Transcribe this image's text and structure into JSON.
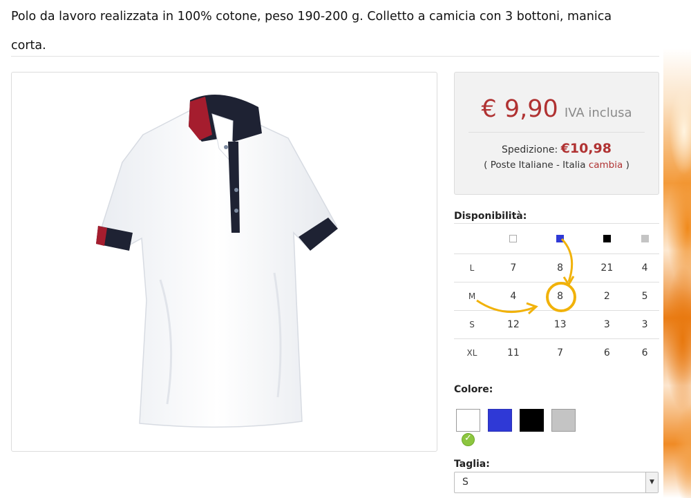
{
  "product": {
    "description": "Polo da lavoro realizzata in 100% cotone, peso 190-200 g. Colletto a camicia con 3 bottoni, manica corta."
  },
  "price": {
    "amount": "€ 9,90",
    "vat_note": "IVA inclusa"
  },
  "shipping": {
    "label": "Spedizione:",
    "price": "€10,98",
    "detail_open": "( Poste Italiane - Italia",
    "change_link": "cambia",
    "detail_close": ")"
  },
  "availability": {
    "label": "Disponibilità:",
    "colors": [
      {
        "name": "white",
        "hex": "#ffffff"
      },
      {
        "name": "blue",
        "hex": "#2f39d6"
      },
      {
        "name": "black",
        "hex": "#000000"
      },
      {
        "name": "grey",
        "hex": "#c4c4c4"
      }
    ],
    "rows": [
      {
        "size": "L",
        "values": [
          "7",
          "8",
          "21",
          "4"
        ]
      },
      {
        "size": "M",
        "values": [
          "4",
          "8",
          "2",
          "5"
        ]
      },
      {
        "size": "S",
        "values": [
          "12",
          "13",
          "3",
          "3"
        ]
      },
      {
        "size": "XL",
        "values": [
          "11",
          "7",
          "6",
          "6"
        ]
      }
    ],
    "highlighted_cell": {
      "size": "M",
      "color": "blue",
      "value": "8"
    }
  },
  "color_picker": {
    "label": "Colore:",
    "options": [
      {
        "name": "white",
        "hex": "#ffffff",
        "selected": true
      },
      {
        "name": "blue",
        "hex": "#2f39d6",
        "selected": false
      },
      {
        "name": "black",
        "hex": "#000000",
        "selected": false
      },
      {
        "name": "grey",
        "hex": "#c4c4c4",
        "selected": false
      }
    ],
    "selected_icon": "check-circle-icon"
  },
  "size_picker": {
    "label": "Taglia:",
    "selected": "S",
    "arrow_icon": "chevron-down-icon"
  },
  "theme": {
    "accent": "#b03232",
    "highlight": "#f1b20a",
    "check_green": "#8cc63f"
  }
}
